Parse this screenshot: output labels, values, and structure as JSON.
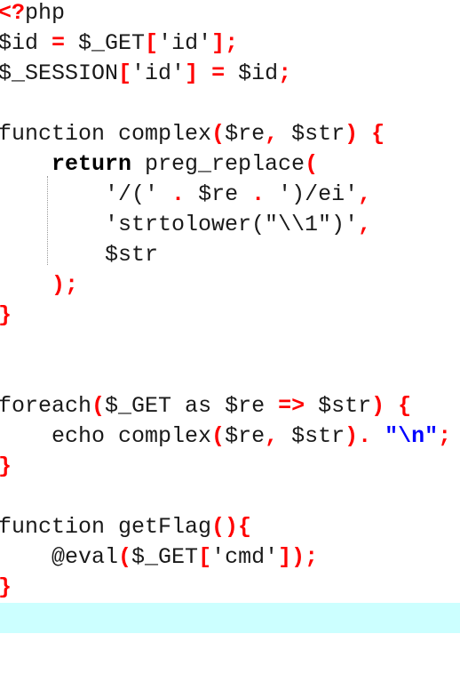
{
  "editor": {
    "current_line_color": "#ccffff",
    "colors": {
      "punctuation": "#ff0000",
      "string_escape": "#0000ff",
      "text": "#1a1a1a"
    },
    "lines": [
      [
        {
          "t": "<?",
          "c": "p"
        },
        {
          "t": "php",
          "c": "k"
        }
      ],
      [
        {
          "t": "$id ",
          "c": "k"
        },
        {
          "t": "=",
          "c": "p"
        },
        {
          "t": " $_GET",
          "c": "k"
        },
        {
          "t": "[",
          "c": "p"
        },
        {
          "t": "'id'",
          "c": "k"
        },
        {
          "t": "];",
          "c": "p"
        }
      ],
      [
        {
          "t": "$_SESSION",
          "c": "k"
        },
        {
          "t": "[",
          "c": "p"
        },
        {
          "t": "'id'",
          "c": "k"
        },
        {
          "t": "]",
          "c": "p"
        },
        {
          "t": " ",
          "c": "k"
        },
        {
          "t": "=",
          "c": "p"
        },
        {
          "t": " $id",
          "c": "k"
        },
        {
          "t": ";",
          "c": "p"
        }
      ],
      [],
      [
        {
          "t": "function complex",
          "c": "k"
        },
        {
          "t": "(",
          "c": "p"
        },
        {
          "t": "$re",
          "c": "k"
        },
        {
          "t": ",",
          "c": "p"
        },
        {
          "t": " $str",
          "c": "k"
        },
        {
          "t": ")",
          "c": "p"
        },
        {
          "t": " ",
          "c": "k"
        },
        {
          "t": "{",
          "c": "p"
        }
      ],
      [
        {
          "t": "    ",
          "c": "k"
        },
        {
          "t": "return",
          "c": "b"
        },
        {
          "t": " preg_replace",
          "c": "k"
        },
        {
          "t": "(",
          "c": "p"
        }
      ],
      [
        {
          "t": "        '/(' ",
          "c": "k"
        },
        {
          "t": ".",
          "c": "p"
        },
        {
          "t": " $re ",
          "c": "k"
        },
        {
          "t": ".",
          "c": "p"
        },
        {
          "t": " ')/ei'",
          "c": "k"
        },
        {
          "t": ",",
          "c": "p"
        }
      ],
      [
        {
          "t": "        'strtolower(\"\\\\1\")'",
          "c": "k"
        },
        {
          "t": ",",
          "c": "p"
        }
      ],
      [
        {
          "t": "        $str",
          "c": "k"
        }
      ],
      [
        {
          "t": "    ",
          "c": "k"
        },
        {
          "t": ");",
          "c": "p"
        }
      ],
      [
        {
          "t": "}",
          "c": "p"
        }
      ],
      [],
      [],
      [
        {
          "t": "foreach",
          "c": "k"
        },
        {
          "t": "(",
          "c": "p"
        },
        {
          "t": "$_GET as $re ",
          "c": "k"
        },
        {
          "t": "=>",
          "c": "p"
        },
        {
          "t": " $str",
          "c": "k"
        },
        {
          "t": ")",
          "c": "p"
        },
        {
          "t": " ",
          "c": "k"
        },
        {
          "t": "{",
          "c": "p"
        }
      ],
      [
        {
          "t": "    echo complex",
          "c": "k"
        },
        {
          "t": "(",
          "c": "p"
        },
        {
          "t": "$re",
          "c": "k"
        },
        {
          "t": ",",
          "c": "p"
        },
        {
          "t": " $str",
          "c": "k"
        },
        {
          "t": ").",
          "c": "p"
        },
        {
          "t": " ",
          "c": "k"
        },
        {
          "t": "\"\\n\"",
          "c": "s"
        },
        {
          "t": ";",
          "c": "p"
        }
      ],
      [
        {
          "t": "}",
          "c": "p"
        }
      ],
      [],
      [
        {
          "t": "function getFlag",
          "c": "k"
        },
        {
          "t": "(){",
          "c": "p"
        }
      ],
      [
        {
          "t": "    @eval",
          "c": "k"
        },
        {
          "t": "(",
          "c": "p"
        },
        {
          "t": "$_GET",
          "c": "k"
        },
        {
          "t": "[",
          "c": "p"
        },
        {
          "t": "'cmd'",
          "c": "k"
        },
        {
          "t": "]);",
          "c": "p"
        }
      ],
      [
        {
          "t": "}",
          "c": "p"
        }
      ],
      []
    ],
    "current_line": 21
  }
}
